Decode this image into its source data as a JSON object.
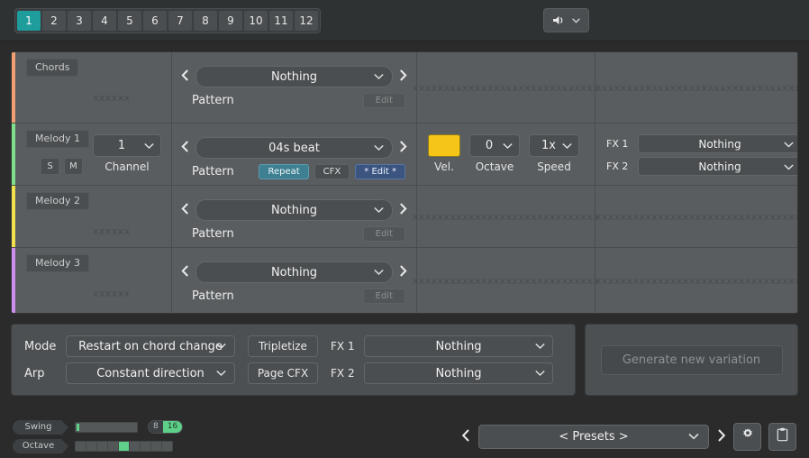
{
  "topbar": {
    "tabs": [
      "1",
      "2",
      "3",
      "4",
      "5",
      "6",
      "7",
      "8",
      "9",
      "10",
      "11",
      "12"
    ],
    "active_tab_index": 0,
    "volume_icon": "speaker-icon",
    "volume_chevron": "chevron-down-icon"
  },
  "tracks": [
    {
      "name": "Chords",
      "accent": "#f0a070",
      "name_placeholder": "xxxxxx",
      "pattern_value": "Nothing",
      "pattern_label": "Pattern",
      "edit_label": "Edit",
      "mid_placeholder": "xxxxxxxxxxxxxxxxxxxxxxxxxxxxxx",
      "fx_placeholder": "xxxxxxxxxxxxxxxxxxxxxxxxxxxxxxxxxxx",
      "has_controls": false
    },
    {
      "name": "Melody 1",
      "accent": "#7ee08a",
      "solo_label": "S",
      "mute_label": "M",
      "channel_value": "1",
      "channel_label": "Channel",
      "pattern_value": "04s beat",
      "pattern_label": "Pattern",
      "repeat_label": "Repeat",
      "cfx_label": "CFX",
      "edit_label": "* Edit *",
      "vel_label": "Vel.",
      "vel_color": "#f5c518",
      "octave_value": "0",
      "octave_label": "Octave",
      "speed_value": "1x",
      "speed_label": "Speed",
      "fx1_label": "FX 1",
      "fx1_value": "Nothing",
      "fx2_label": "FX 2",
      "fx2_value": "Nothing",
      "has_controls": true
    },
    {
      "name": "Melody 2",
      "accent": "#f2e14c",
      "name_placeholder": "xxxxxx",
      "pattern_value": "Nothing",
      "pattern_label": "Pattern",
      "edit_label": "Edit",
      "mid_placeholder": "xxxxxxxxxxxxxxxxxxxxxxxxxxxxxx",
      "fx_placeholder": "xxxxxxxxxxxxxxxxxxxxxxxxxxxxxxxxxxx",
      "has_controls": false
    },
    {
      "name": "Melody 3",
      "accent": "#cd8ef0",
      "name_placeholder": "xxxxxx",
      "pattern_value": "Nothing",
      "pattern_label": "Pattern",
      "edit_label": "Edit",
      "mid_placeholder": "xxxxxxxxxxxxxxxxxxxxxxxxxxxxxx",
      "fx_placeholder": "xxxxxxxxxxxxxxxxxxxxxxxxxxxxxxxxxxx",
      "has_controls": false
    }
  ],
  "panel": {
    "mode_label": "Mode",
    "mode_value": "Restart on chord change",
    "arp_label": "Arp",
    "arp_value": "Constant direction",
    "tripletize_label": "Tripletize",
    "page_cfx_label": "Page CFX",
    "fx1_label": "FX 1",
    "fx1_value": "Nothing",
    "fx2_label": "FX 2",
    "fx2_value": "Nothing",
    "generate_label": "Generate new variation"
  },
  "footer": {
    "swing_label": "Swing",
    "swing_snap": [
      "8",
      "16"
    ],
    "swing_snap_active_index": 1,
    "octave_label": "Octave",
    "octave_segments": 9,
    "octave_active_index": 4,
    "preset_value": "< Presets >",
    "prev_icon": "chevron-left-icon",
    "next_icon": "chevron-right-icon",
    "gear_icon": "gear-icon",
    "clipboard_icon": "clipboard-icon"
  },
  "colors": {
    "accent_teal": "#1f9c9c",
    "accent_green": "#5fd08a",
    "panel_bg": "#4d5052",
    "track_bg": "#5a5d5f"
  }
}
